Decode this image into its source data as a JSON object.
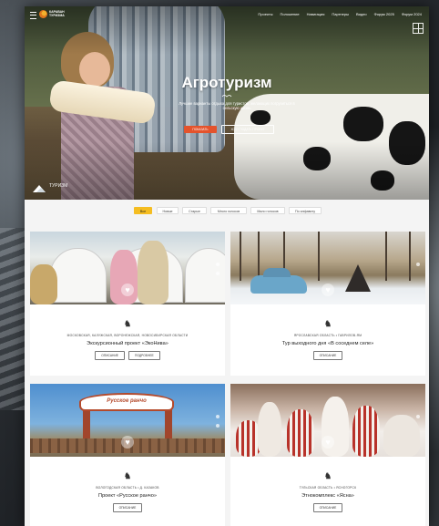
{
  "header": {
    "logo_text": "КАРАВАН ТУРИЗМА",
    "nav": [
      "Проекты",
      "Положение",
      "Навигация",
      "Партнеры",
      "Видео",
      "Форум 2025",
      "Форум 2024"
    ]
  },
  "hero": {
    "title": "Агротуризм",
    "subtitle": "Лучшие варианты отдыха для туристов, желающих погрузиться в сельскую жизнь",
    "primary_button": "ПОКАЗАТЬ",
    "secondary_button": "ХОЧУ ПОДАТЬ ПРОЕКТ",
    "tag_label": "ТУРИЗМ"
  },
  "filters": [
    "Все",
    "Новые",
    "Старые",
    "Много голосов",
    "Мало голосов",
    "По алфавиту"
  ],
  "active_filter": "Все",
  "colors": {
    "accent": "#f5bd21",
    "primary_button": "#e4532c",
    "card_bg": "#ffffff",
    "page_bg": "#f4f4f4"
  },
  "cards": [
    {
      "region": "МОСКОВСКАЯ, КАЛУЖСКАЯ, ВОРОНЕЖСКАЯ, НОВОСИБИРСКАЯ ОБЛАСТИ",
      "title": "Экскурсионный проект «ЭкоНива»",
      "buttons": [
        "ОПИСАНИЕ",
        "ПОДРОБНЕЕ"
      ]
    },
    {
      "region": "ЯРОСЛАВСКАЯ ОБЛАСТЬ • ГАВРИЛОВ-ЯМ",
      "title": "Тур выходного дня «В соседнем селе»",
      "buttons": [
        "ОПИСАНИЕ"
      ]
    },
    {
      "region": "ВОЛОГОДСКАЯ ОБЛАСТЬ • Д. КАЗАКОВ",
      "title": "Проект «Русское ранчо»",
      "buttons": [
        "ОПИСАНИЕ"
      ],
      "sign_text": "Русское ранчо"
    },
    {
      "region": "ТУЛЬСКАЯ ОБЛАСТЬ • ЯСНОГОРСК",
      "title": "Этнокомплекс «Ясна»",
      "buttons": [
        "ОПИСАНИЕ"
      ]
    }
  ]
}
